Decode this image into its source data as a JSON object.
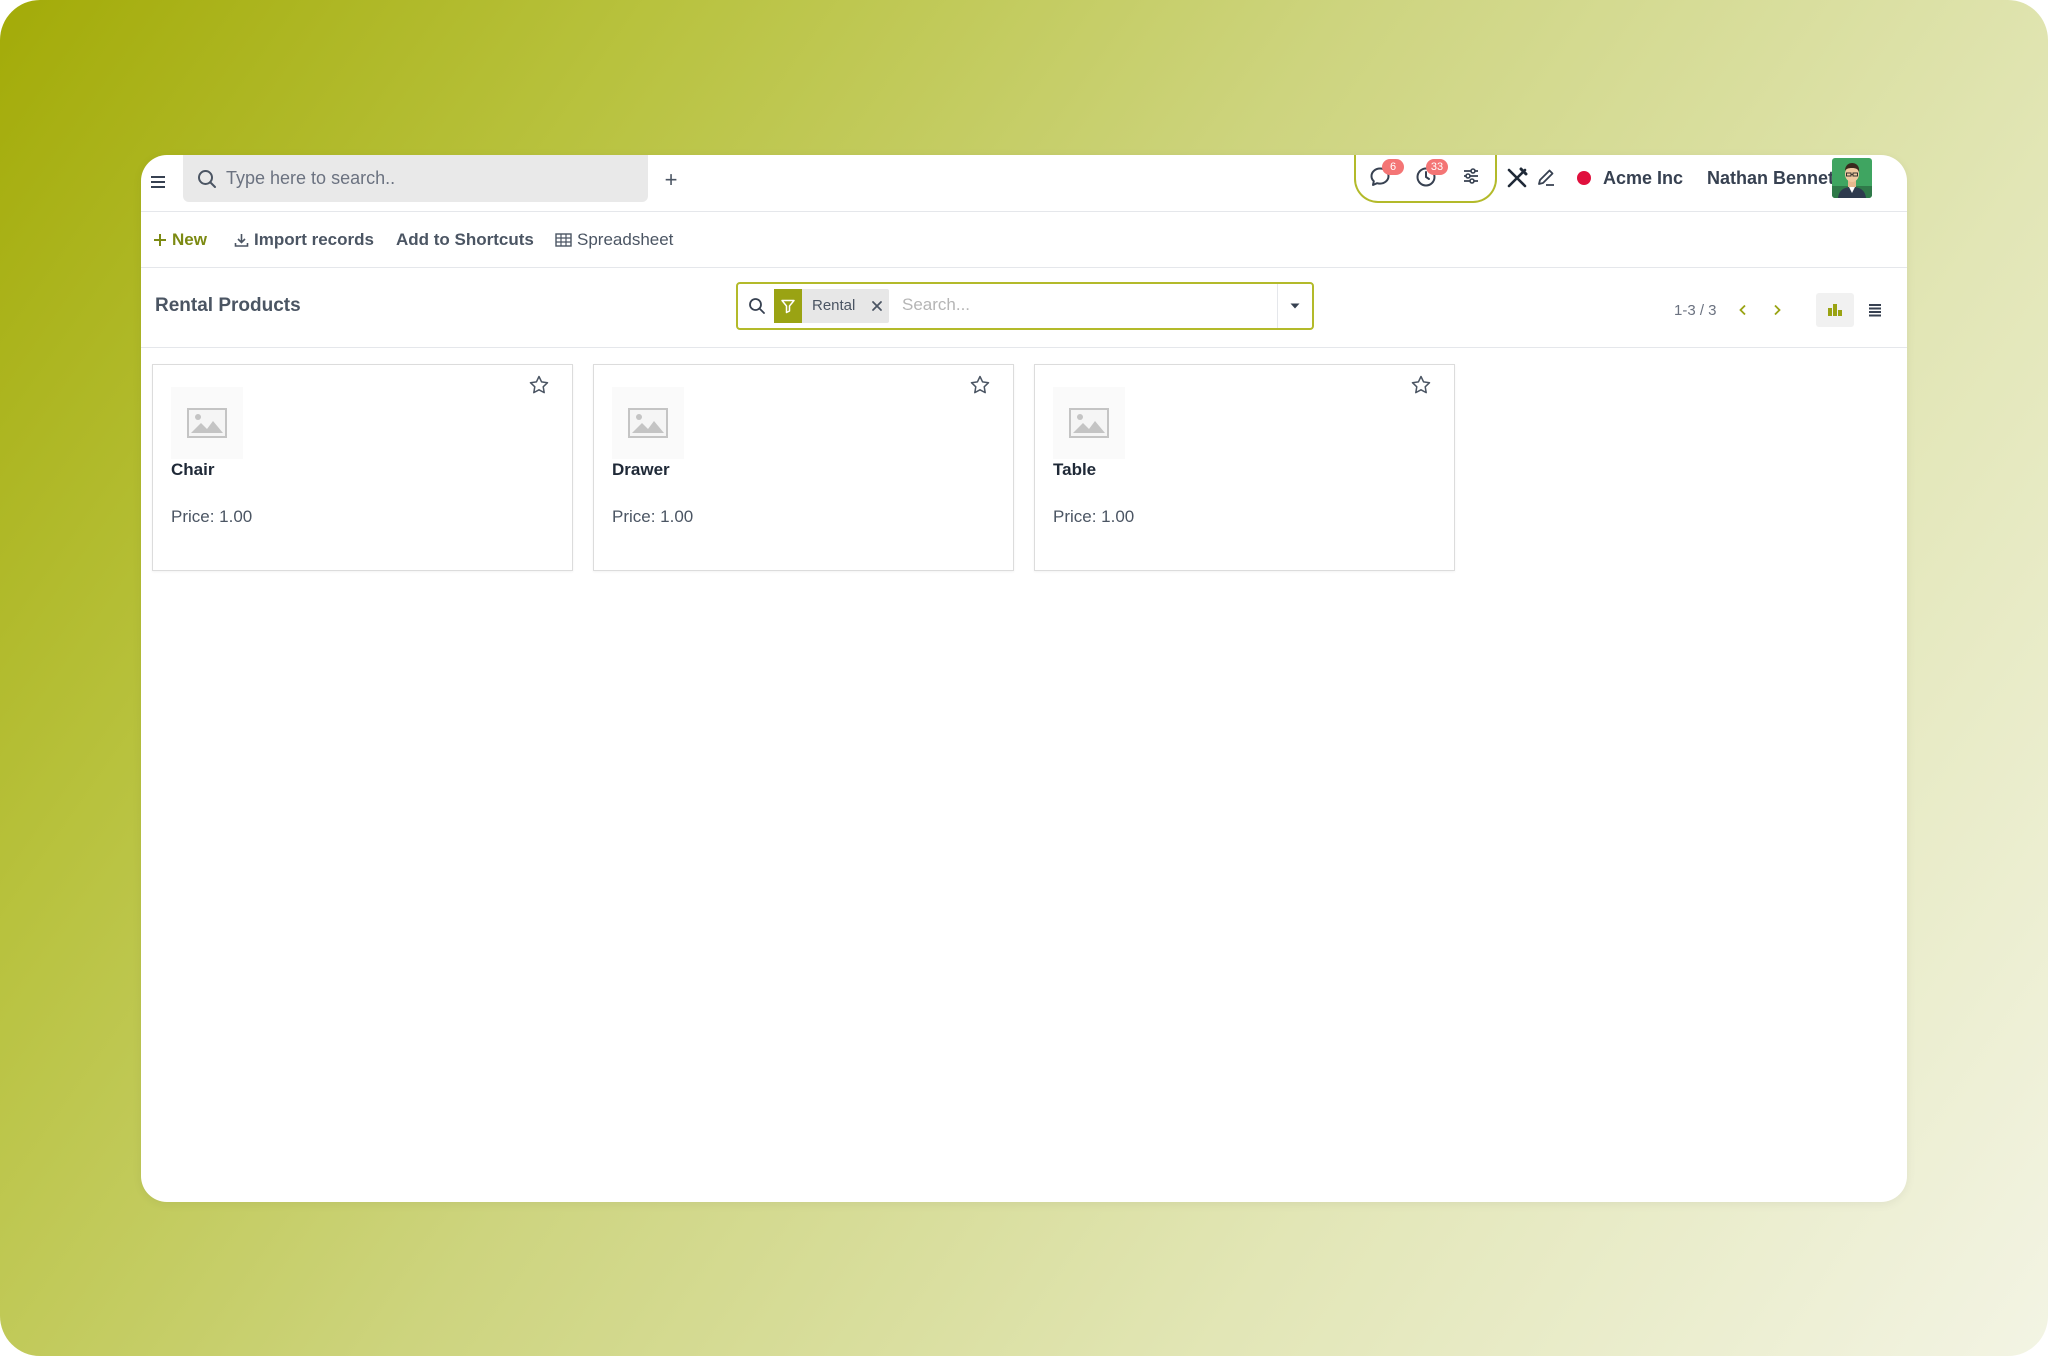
{
  "topbar": {
    "search_placeholder": "Type here to search..",
    "messages_badge": "6",
    "activities_badge": "33",
    "company": "Acme Inc",
    "user": "Nathan Bennet"
  },
  "actions": {
    "new": "New",
    "import": "Import records",
    "shortcuts": "Add to Shortcuts",
    "spreadsheet": "Spreadsheet"
  },
  "control_panel": {
    "title": "Rental Products",
    "facet_label": "Rental",
    "search_placeholder": "Search...",
    "pager": "1-3 / 3"
  },
  "products": [
    {
      "name": "Chair",
      "price": "Price: 1.00"
    },
    {
      "name": "Drawer",
      "price": "Price: 1.00"
    },
    {
      "name": "Table",
      "price": "Price: 1.00"
    }
  ],
  "colors": {
    "accent": "#9aa313",
    "badge": "#f47575",
    "status": "#e0103d"
  }
}
